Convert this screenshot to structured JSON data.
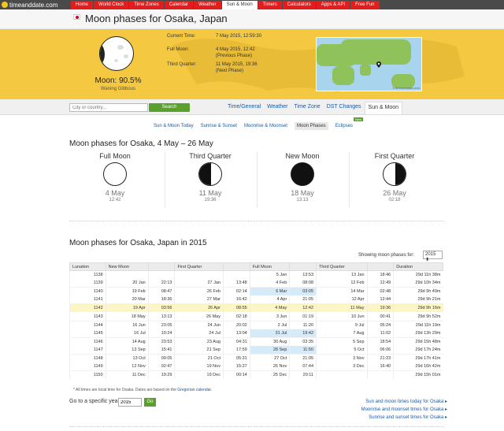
{
  "nav": {
    "logo": "timeanddate.com",
    "tabs": [
      "Home",
      "World Clock",
      "Time Zones",
      "Calendar",
      "Weather",
      "Sun & Moon",
      "Timers",
      "Calculators",
      "Apps & API",
      "Free Fun"
    ],
    "active_tab": "Sun & Moon"
  },
  "header": {
    "title": "Moon phases for Osaka, Japan"
  },
  "hero": {
    "moon_percent": "Moon: 90.5%",
    "moon_state": "Waning Gibbous",
    "rows": [
      {
        "label": "Current Time:",
        "value": "7 May 2015, 12:59:30"
      },
      {
        "label": "Full Moon:",
        "value": "4 May 2015, 12:42",
        "note": "(Previous Phase)"
      },
      {
        "label": "Third Quarter:",
        "value": "11 May 2015, 19:36",
        "note": "(Next Phase)"
      }
    ],
    "map_credit": "© timeanddate.com"
  },
  "search": {
    "placeholder": "City or country...",
    "button": "Search"
  },
  "subtabs": [
    "Time/General",
    "Weather",
    "Time Zone",
    "DST Changes",
    "Sun & Moon"
  ],
  "subtab_active": "Sun & Moon",
  "sublinks": [
    "Sun & Moon Today",
    "Sunrise & Sunset",
    "Moonrise & Moonset",
    "Moon Phases",
    "Eclipses"
  ],
  "sublink_active": "Moon Phases",
  "new_badge": "New",
  "section1": {
    "heading": "Moon phases for Osaka, 4 May – 26 May",
    "phases": [
      {
        "name": "Full Moon",
        "date": "4 May",
        "time": "12:42",
        "icon": "full"
      },
      {
        "name": "Third Quarter",
        "date": "11 May",
        "time": "19:36",
        "icon": "third"
      },
      {
        "name": "New Moon",
        "date": "18 May",
        "time": "13:13",
        "icon": "new"
      },
      {
        "name": "First Quarter",
        "date": "26 May",
        "time": "02:18",
        "icon": "first"
      }
    ]
  },
  "section2": {
    "heading": "Moon phases for Osaka, Japan in 2015",
    "showing_label": "Showing moon phases for:",
    "year": "2015",
    "columns": [
      "Lunation",
      "New Moon",
      "",
      "First Quarter",
      "",
      "Full Moon",
      "",
      "Third Quarter",
      "",
      "Duration"
    ],
    "rows": [
      [
        "1138",
        "",
        "",
        "",
        "",
        "5 Jan",
        "13:53",
        "13 Jan",
        "18:46",
        "29d 11h 38m"
      ],
      [
        "1139",
        "20 Jan",
        "22:13",
        "27 Jan",
        "13:48",
        "4 Feb",
        "08:08",
        "12 Feb",
        "12:49",
        "29d 10h 34m"
      ],
      [
        "1140",
        "19 Feb",
        "08:47",
        "26 Feb",
        "02:14",
        "6 Mar",
        "03:05",
        "14 Mar",
        "02:48",
        "29d 9h 49m"
      ],
      [
        "1141",
        "20 Mar",
        "18:36",
        "27 Mar",
        "16:42",
        "4 Apr",
        "21:05",
        "12 Apr",
        "12:44",
        "29d 9h 21m"
      ],
      [
        "1142",
        "19 Apr",
        "03:56",
        "26 Apr",
        "08:55",
        "4 May",
        "12:42",
        "11 May",
        "19:36",
        "29d 9h 16m"
      ],
      [
        "1143",
        "18 May",
        "13:13",
        "26 May",
        "02:18",
        "3 Jun",
        "01:19",
        "10 Jun",
        "00:41",
        "29d 9h 52m"
      ],
      [
        "1144",
        "16 Jun",
        "23:05",
        "24 Jun",
        "20:02",
        "2 Jul",
        "11:20",
        "9 Jul",
        "05:24",
        "29d 11h 19m"
      ],
      [
        "1145",
        "16 Jul",
        "10:24",
        "24 Jul",
        "13:04",
        "31 Jul",
        "19:42",
        "7 Aug",
        "11:02",
        "29d 13h 29m"
      ],
      [
        "1146",
        "14 Aug",
        "23:53",
        "23 Aug",
        "04:31",
        "30 Aug",
        "03:35",
        "5 Sep",
        "18:54",
        "29d 15h 48m"
      ],
      [
        "1147",
        "13 Sep",
        "15:41",
        "21 Sep",
        "17:59",
        "28 Sep",
        "11:50",
        "5 Oct",
        "06:06",
        "29d 17h 24m"
      ],
      [
        "1148",
        "13 Oct",
        "09:05",
        "21 Oct",
        "05:31",
        "27 Oct",
        "21:05",
        "3 Nov",
        "21:23",
        "29d 17h 41m"
      ],
      [
        "1149",
        "12 Nov",
        "02:47",
        "19 Nov",
        "15:27",
        "26 Nov",
        "07:44",
        "3 Dec",
        "16:40",
        "29d 16h 42m"
      ],
      [
        "1150",
        "11 Dec",
        "19:29",
        "19 Dec",
        "00:14",
        "25 Dec",
        "20:11",
        "",
        "",
        "29d 15h 01m"
      ]
    ],
    "footnote_pre": "* All times are local time for Osaka. Dates are based on the ",
    "footnote_link": "Gregorian calendar",
    "footnote_post": ".",
    "goto_label": "Go to a specific year:",
    "goto_value": "2015",
    "go_button": "Go",
    "links": [
      "Sun and moon times today for Osaka",
      "Moonrise and moonset times for Osaka",
      "Sunrise and sunset times for Osaka"
    ]
  }
}
